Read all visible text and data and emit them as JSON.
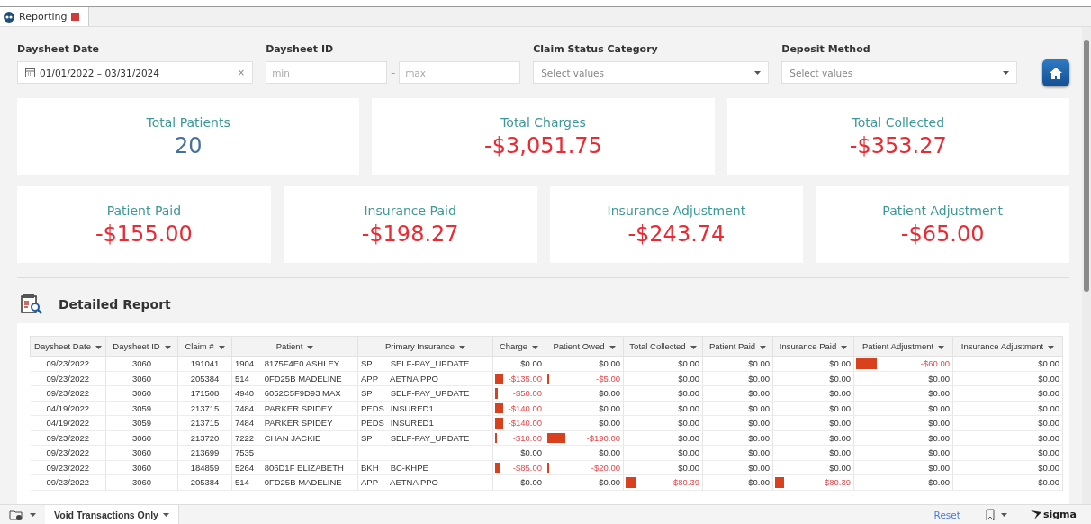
{
  "tab": {
    "label": "Reporting",
    "selected": true
  },
  "filters": [
    {
      "kind": "date",
      "label": "Daysheet Date",
      "value": "01/01/2022 – 03/31/2024",
      "clear": "×"
    },
    {
      "kind": "range",
      "label": "Daysheet ID",
      "min_placeholder": "min",
      "separator": "–",
      "max_placeholder": "max"
    },
    {
      "kind": "select",
      "label": "Claim Status Category",
      "placeholder": "Select values"
    },
    {
      "kind": "select",
      "label": "Deposit Method",
      "placeholder": "Select values"
    }
  ],
  "kpi_rows": [
    [
      {
        "title": "Total Patients",
        "value": "20",
        "negative": false
      },
      {
        "title": "Total Charges",
        "value": "-$3,051.75",
        "negative": true
      },
      {
        "title": "Total Collected",
        "value": "-$353.27",
        "negative": true
      }
    ],
    [
      {
        "title": "Patient Paid",
        "value": "-$155.00",
        "negative": true
      },
      {
        "title": "Insurance Paid",
        "value": "-$198.27",
        "negative": true
      },
      {
        "title": "Insurance Adjustment",
        "value": "-$243.74",
        "negative": true
      },
      {
        "title": "Patient Adjustment",
        "value": "-$65.00",
        "negative": true
      }
    ]
  ],
  "report": {
    "title": "Detailed Report",
    "columns": [
      "Daysheet Date",
      "Daysheet ID",
      "Claim #",
      "Patient",
      "Primary Insurance",
      "Charge",
      "Patient Owed",
      "Total Collected",
      "Patient Paid",
      "Insurance Paid",
      "Patient Adjustment",
      "Insurance Adjustment"
    ],
    "rows": [
      {
        "date": "09/23/2022",
        "daysheet_id": "3060",
        "claim": "191041",
        "patient_id": "1904",
        "patient": "8175F4E0 ASHLEY",
        "ins_code": "SP",
        "insurance": "SELF-PAY_UPDATE",
        "amounts": [
          {
            "text": "$0.00"
          },
          {
            "text": "$0.00"
          },
          {
            "text": "$0.00"
          },
          {
            "text": "$0.00"
          },
          {
            "text": "$0.00"
          },
          {
            "text": "-$60.00",
            "level": 0.22
          },
          {
            "text": "$0.00"
          }
        ]
      },
      {
        "date": "09/23/2022",
        "daysheet_id": "3060",
        "claim": "205384",
        "patient_id": "514",
        "patient": "0FD25B MADELINE",
        "ins_code": "APP",
        "insurance": "AETNA PPO",
        "amounts": [
          {
            "text": "-$135.00",
            "level": 0.17
          },
          {
            "text": "-$5.00",
            "level": 0.03
          },
          {
            "text": "$0.00"
          },
          {
            "text": "$0.00"
          },
          {
            "text": "$0.00"
          },
          {
            "text": "$0.00"
          },
          {
            "text": "$0.00"
          }
        ]
      },
      {
        "date": "09/23/2022",
        "daysheet_id": "3060",
        "claim": "171508",
        "patient_id": "4940",
        "patient": "6052C5F9D93 MAX",
        "ins_code": "SP",
        "insurance": "SELF-PAY_UPDATE",
        "amounts": [
          {
            "text": "-$50.00",
            "level": 0.06
          },
          {
            "text": "$0.00"
          },
          {
            "text": "$0.00"
          },
          {
            "text": "$0.00"
          },
          {
            "text": "$0.00"
          },
          {
            "text": "$0.00"
          },
          {
            "text": "$0.00"
          }
        ]
      },
      {
        "date": "04/19/2022",
        "daysheet_id": "3059",
        "claim": "213715",
        "patient_id": "7484",
        "patient": "PARKER SPIDEY",
        "ins_code": "PEDS",
        "insurance": "INSURED1",
        "amounts": [
          {
            "text": "-$140.00",
            "level": 0.18
          },
          {
            "text": "$0.00"
          },
          {
            "text": "$0.00"
          },
          {
            "text": "$0.00"
          },
          {
            "text": "$0.00"
          },
          {
            "text": "$0.00"
          },
          {
            "text": "$0.00"
          }
        ]
      },
      {
        "date": "04/19/2022",
        "daysheet_id": "3059",
        "claim": "213715",
        "patient_id": "7484",
        "patient": "PARKER SPIDEY",
        "ins_code": "PEDS",
        "insurance": "INSURED1",
        "amounts": [
          {
            "text": "-$140.00",
            "level": 0.18
          },
          {
            "text": "$0.00"
          },
          {
            "text": "$0.00"
          },
          {
            "text": "$0.00"
          },
          {
            "text": "$0.00"
          },
          {
            "text": "$0.00"
          },
          {
            "text": "$0.00"
          }
        ]
      },
      {
        "date": "09/23/2022",
        "daysheet_id": "3060",
        "claim": "213720",
        "patient_id": "7222",
        "patient": "CHAN JACKIE",
        "ins_code": "SP",
        "insurance": "SELF-PAY_UPDATE",
        "amounts": [
          {
            "text": "-$10.00",
            "level": 0.04
          },
          {
            "text": "-$190.00",
            "level": 0.25
          },
          {
            "text": "$0.00"
          },
          {
            "text": "$0.00"
          },
          {
            "text": "$0.00"
          },
          {
            "text": "$0.00"
          },
          {
            "text": "$0.00"
          }
        ]
      },
      {
        "date": "09/23/2022",
        "daysheet_id": "3060",
        "claim": "213699",
        "patient_id": "7535",
        "amounts": [
          {
            "text": "$0.00"
          },
          {
            "text": "$0.00"
          },
          {
            "text": "$0.00"
          },
          {
            "text": "$0.00"
          },
          {
            "text": "$0.00"
          },
          {
            "text": "$0.00"
          },
          {
            "text": "$0.00"
          }
        ]
      },
      {
        "date": "09/23/2022",
        "daysheet_id": "3060",
        "claim": "184859",
        "patient_id": "5264",
        "patient": "806D1F ELIZABETH",
        "ins_code": "BKH",
        "insurance": "BC-KHPE",
        "amounts": [
          {
            "text": "-$85.00",
            "level": 0.11
          },
          {
            "text": "-$20.00",
            "level": 0.03
          },
          {
            "text": "$0.00"
          },
          {
            "text": "$0.00"
          },
          {
            "text": "$0.00"
          },
          {
            "text": "$0.00"
          },
          {
            "text": "$0.00"
          }
        ]
      },
      {
        "date": "09/23/2022",
        "daysheet_id": "3060",
        "claim": "205384",
        "patient_id": "514",
        "patient": "0FD25B MADELINE",
        "ins_code": "APP",
        "insurance": "AETNA PPO",
        "amounts": [
          {
            "text": "$0.00"
          },
          {
            "text": "$0.00"
          },
          {
            "text": "-$80.39",
            "level": 0.13
          },
          {
            "text": "$0.00"
          },
          {
            "text": "-$80.39",
            "level": 0.12
          },
          {
            "text": "$0.00"
          },
          {
            "text": "$0.00"
          }
        ]
      }
    ]
  },
  "footer": {
    "filter_tab": "Void Transactions Only",
    "reset": "Reset",
    "brand": "sigma"
  }
}
